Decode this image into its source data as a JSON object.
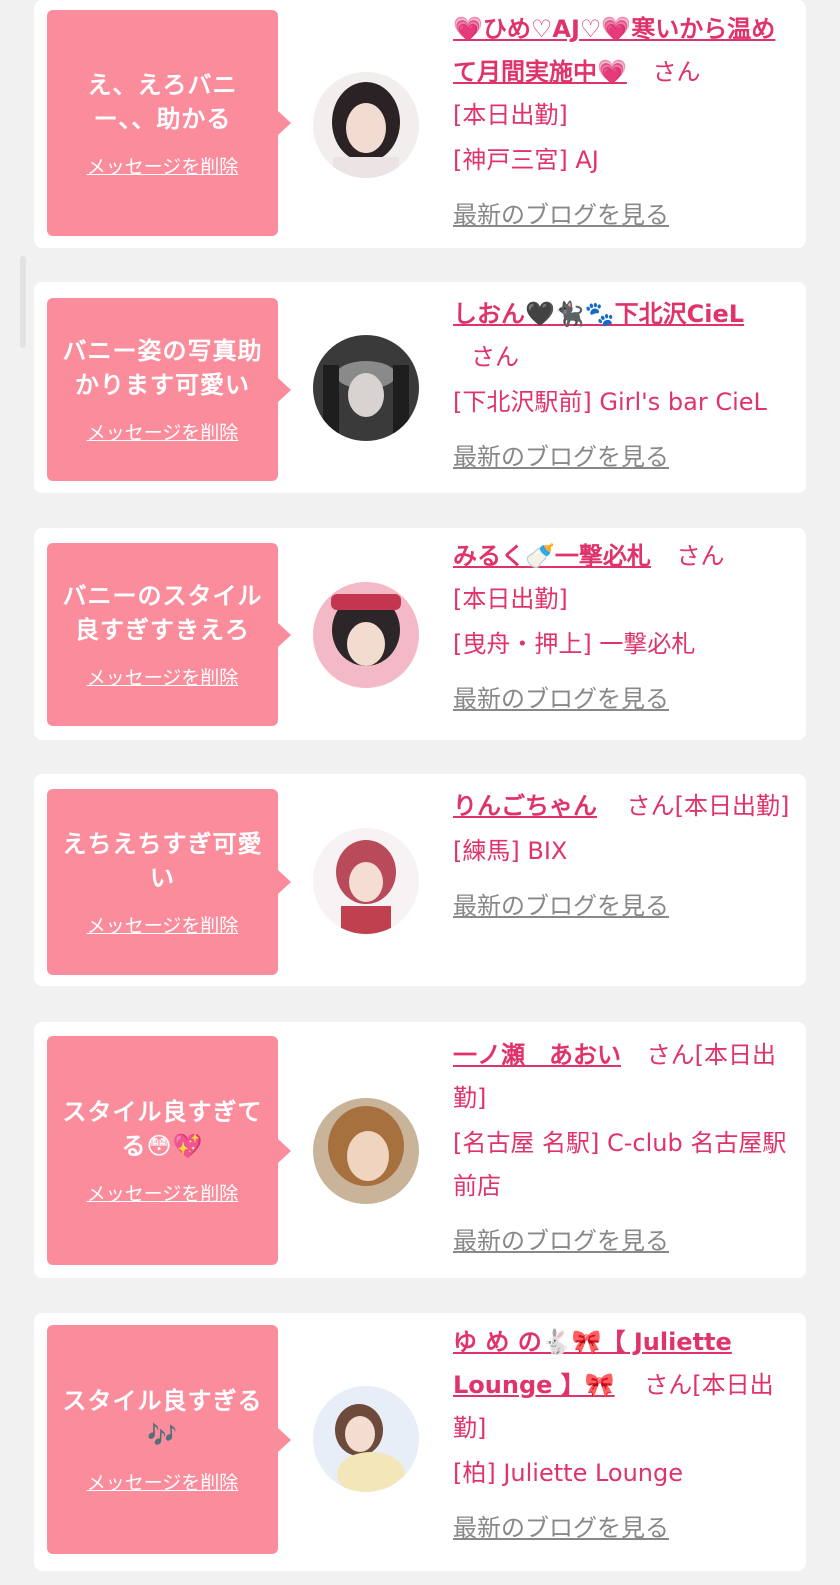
{
  "delete_label": "メッセージを削除",
  "blog_label": "最新のブログを見る",
  "cards": [
    {
      "message": "え、えろバニー、、助かる",
      "name": "💗ひめ♡AJ♡💗寒いから温めて月間実施中💗",
      "suffix": "さん",
      "attendance": "[本日出勤]",
      "location": "[神戸三宮] AJ"
    },
    {
      "message": "バニー姿の写真助かります可愛い",
      "name": "しおん🖤🐈‍⬛🐾下北沢CieL",
      "suffix": "さん",
      "attendance": "",
      "location": "[下北沢駅前] Girl's bar CieL"
    },
    {
      "message": "バニーのスタイル良すぎすきえろ",
      "name": "みるく🍼一撃必札",
      "suffix": "さん",
      "attendance": "[本日出勤]",
      "location": "[曳舟・押上] 一撃必札"
    },
    {
      "message": "えちえちすぎ可愛い",
      "name": "りんごちゃん",
      "suffix": "さん[本日出勤]",
      "attendance": "",
      "location": "[練馬] BIX"
    },
    {
      "message": "スタイル良すぎてる😳💖",
      "name": "一ノ瀬　あおい",
      "suffix": "さん[本日出勤]",
      "attendance": "",
      "location": "[名古屋 名駅] C-club 名古屋駅前店"
    },
    {
      "message": "スタイル良すぎる🎶",
      "name": "ゆ め の🐇🎀【 Juliette Lounge 】🎀",
      "suffix": "さん[本日出勤]",
      "attendance": "",
      "location": "[柏] Juliette Lounge"
    }
  ]
}
